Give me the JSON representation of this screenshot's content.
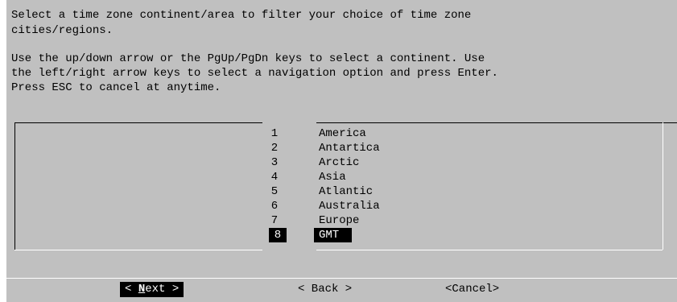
{
  "dialog": {
    "lines": [
      "Select a time zone continent/area to filter your choice of time zone",
      "cities/regions.",
      "Use the up/down arrow or the PgUp/PgDn keys to select a continent. Use",
      "the left/right arrow keys to select a navigation option and press Enter.",
      "Press ESC to cancel at anytime."
    ]
  },
  "list": {
    "selected_index": 7,
    "items": [
      {
        "num": "1",
        "name": "America"
      },
      {
        "num": "2",
        "name": "Antartica"
      },
      {
        "num": "3",
        "name": "Arctic"
      },
      {
        "num": "4",
        "name": "Asia"
      },
      {
        "num": "5",
        "name": "Atlantic"
      },
      {
        "num": "6",
        "name": "Australia"
      },
      {
        "num": "7",
        "name": "Europe"
      },
      {
        "num": "8",
        "name": "GMT"
      }
    ]
  },
  "buttons": {
    "next": {
      "prefix": "< ",
      "hotkey": "N",
      "rest": "ext >"
    },
    "back": "< Back >",
    "cancel": "<Cancel>"
  },
  "colors": {
    "background": "#c0c0c0",
    "highlight": "#000000",
    "highlight_text": "#ffffff"
  }
}
